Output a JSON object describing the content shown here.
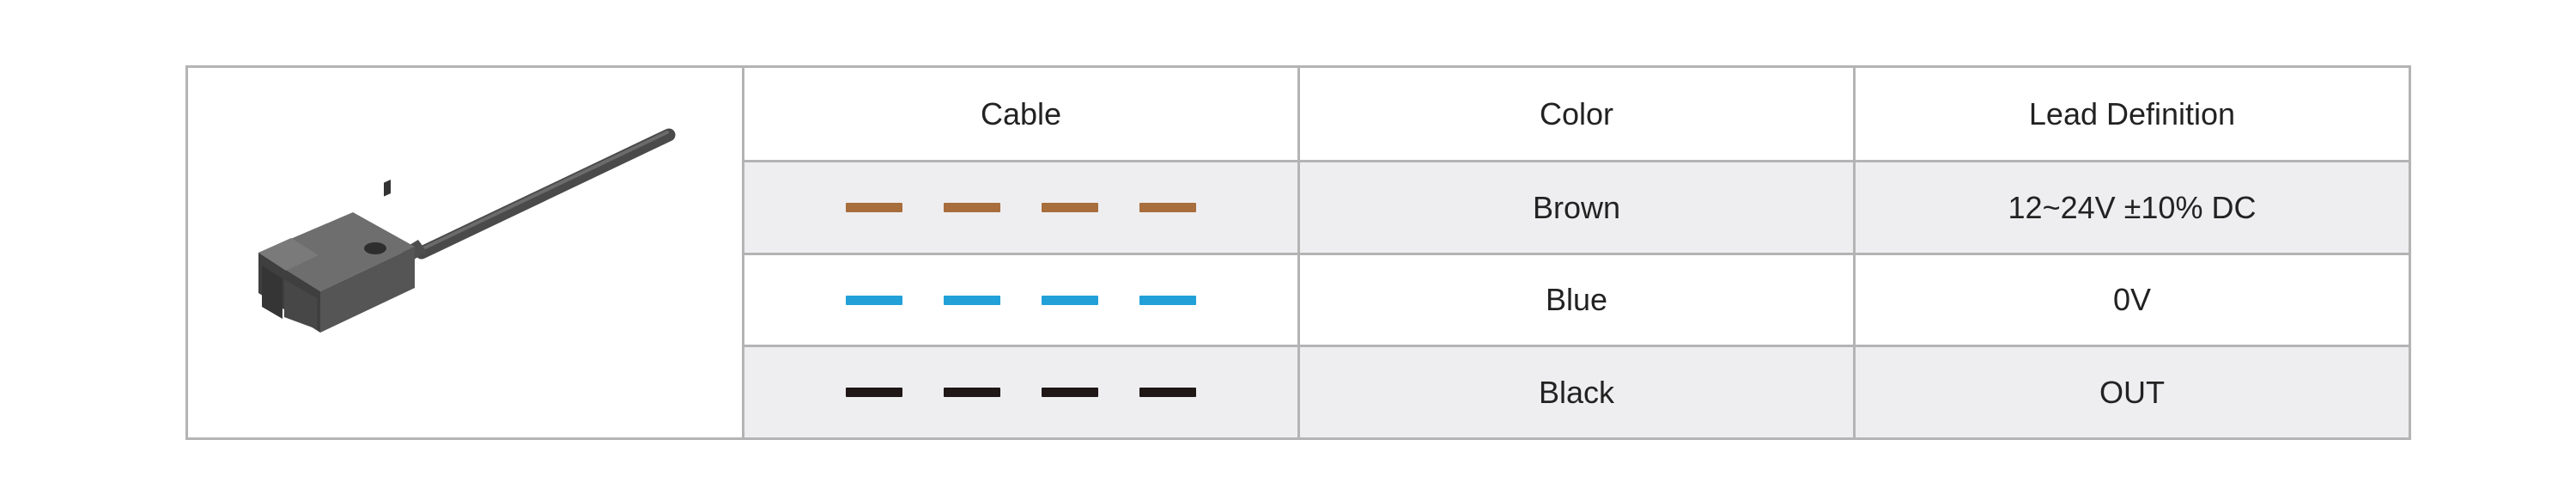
{
  "table": {
    "headers": [
      "Cable",
      "Color",
      "Lead Definition"
    ],
    "rows": [
      {
        "color_name": "Brown",
        "definition": "12~24V ±10% DC",
        "cable_color": "#a86d3c"
      },
      {
        "color_name": "Blue",
        "definition": "0V",
        "cable_color": "#22a0d8"
      },
      {
        "color_name": "Black",
        "definition": "OUT",
        "cable_color": "#1f1616"
      }
    ]
  },
  "product_image": {
    "icon": "proximity-sensor-icon"
  }
}
